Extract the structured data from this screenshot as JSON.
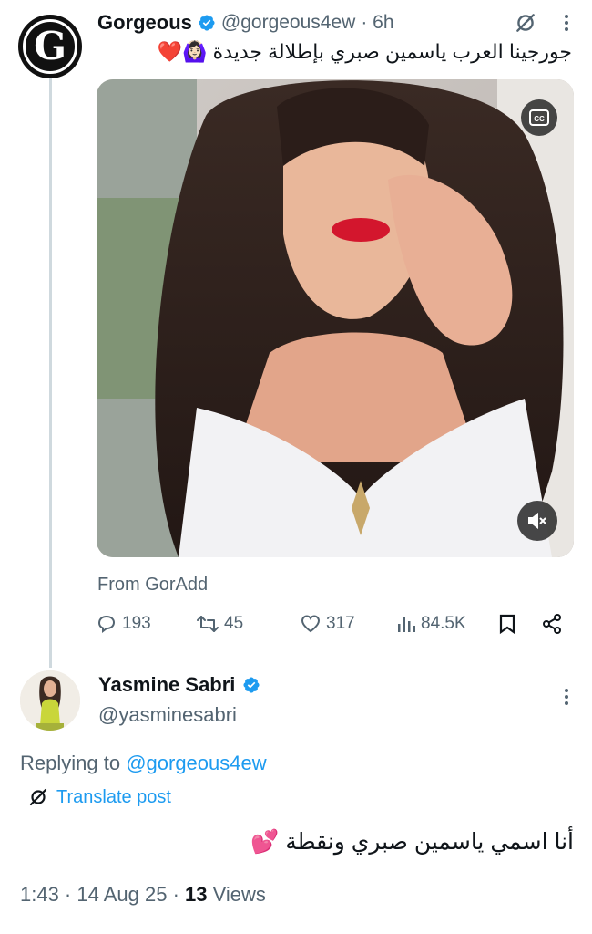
{
  "top_tweet": {
    "author_name": "Gorgeous",
    "author_handle": "@gorgeous4ew",
    "time": "· 6h",
    "avatar_letter": "G",
    "text": "جورجينا العرب ياسمين صبري بإطلالة جديدة 🙆🏻‍♀️❤️",
    "attribution": "From GorAdd",
    "media_controls": {
      "cc_label": "CC"
    },
    "stats": {
      "replies": "193",
      "reposts": "45",
      "likes": "317",
      "views": "84.5K"
    }
  },
  "reply_tweet": {
    "author_name": "Yasmine Sabri",
    "author_handle": "@yasminesabri",
    "replying_label": "Replying to ",
    "replying_handle": "@gorgeous4ew",
    "translate_label": "Translate post",
    "text": "أنا اسمي ياسمين صبري ونقطة 💕",
    "timestamp": "1:43 · 14 Aug 25 · ",
    "views_count": "13",
    "views_label": " Views"
  },
  "icons": {
    "verified": "verified-badge-icon",
    "grok": "grok-icon",
    "more": "more-dots-icon",
    "reply": "reply-icon",
    "repost": "repost-icon",
    "like": "heart-icon",
    "views": "analytics-icon",
    "bookmark": "bookmark-icon",
    "share": "share-icon",
    "mute": "volume-muted-icon",
    "cc": "closed-captions-icon",
    "translate": "translate-icon"
  },
  "colors": {
    "accent": "#1d9bf0",
    "secondary_text": "#536471",
    "primary_text": "#0f1419"
  }
}
